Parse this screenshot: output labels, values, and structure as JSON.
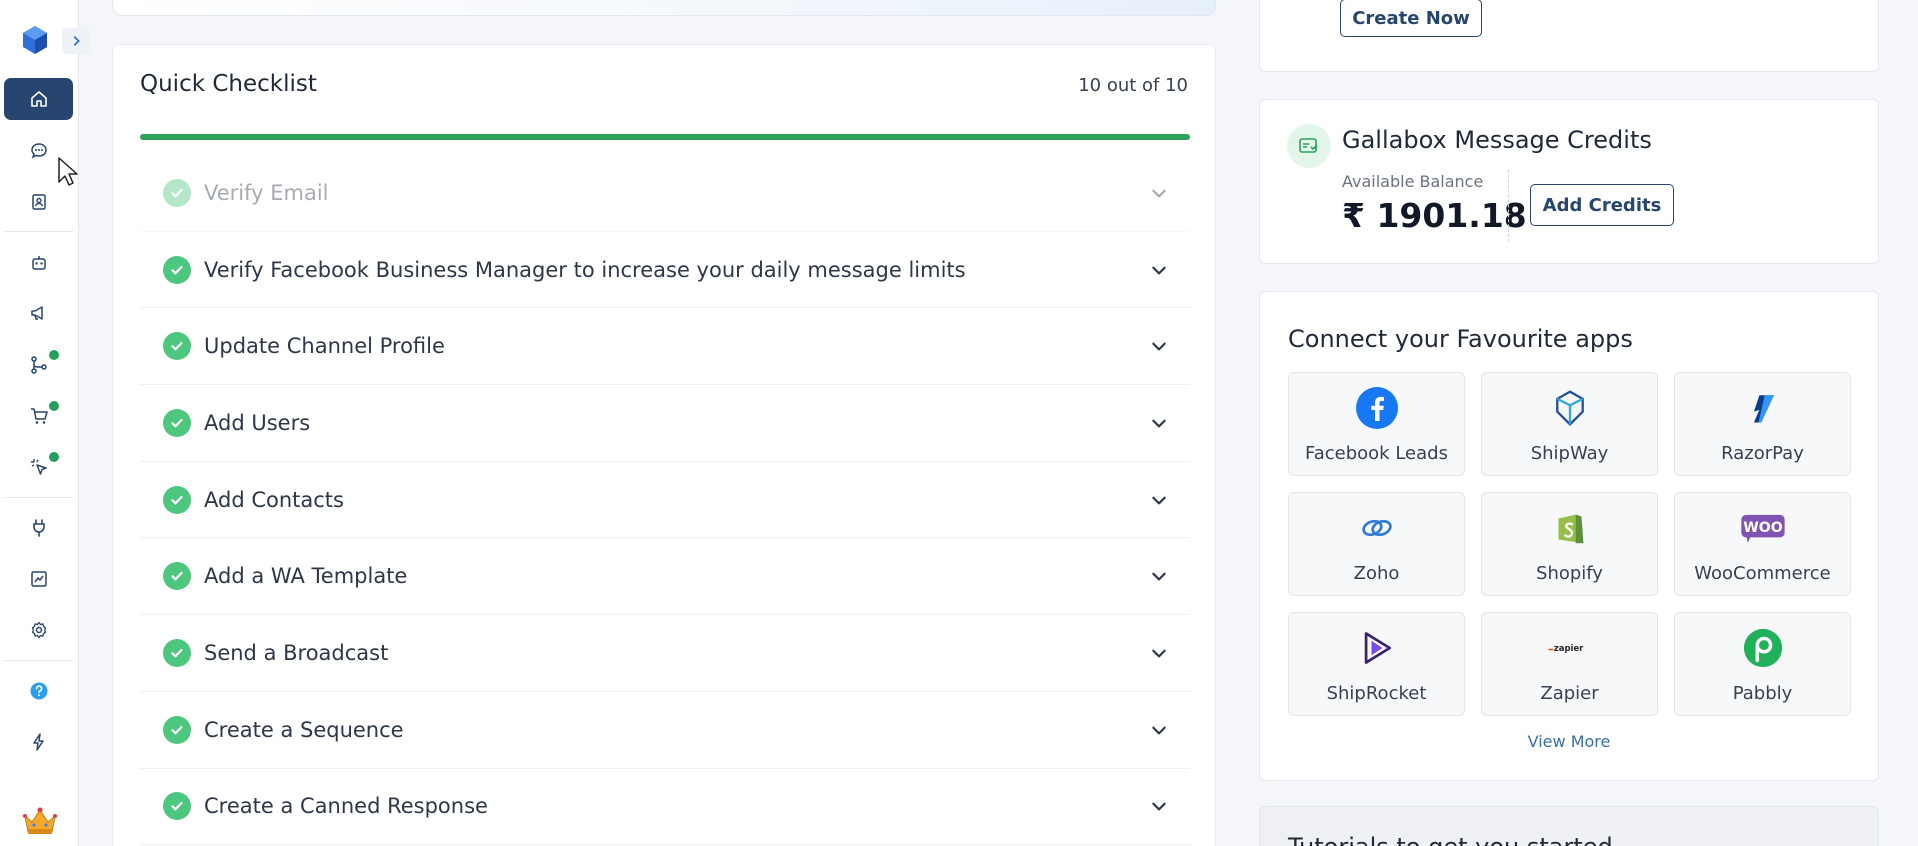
{
  "sidebar": {
    "nav": [
      {
        "id": "home",
        "icon": "home-icon",
        "active": true
      },
      {
        "id": "conversations",
        "icon": "chat-icon"
      },
      {
        "id": "contacts",
        "icon": "contacts-icon"
      },
      {
        "id": "bots",
        "icon": "bot-icon"
      },
      {
        "id": "broadcasts",
        "icon": "megaphone-icon"
      },
      {
        "id": "sequences",
        "icon": "flow-icon",
        "dot": true
      },
      {
        "id": "commerce",
        "icon": "cart-icon",
        "dot": true
      },
      {
        "id": "clicks",
        "icon": "click-icon",
        "dot": true
      },
      {
        "id": "integrations",
        "icon": "plug-icon"
      },
      {
        "id": "analytics",
        "icon": "chart-icon"
      },
      {
        "id": "settings",
        "icon": "gear-icon"
      },
      {
        "id": "help",
        "icon": "help-icon"
      },
      {
        "id": "whats-new",
        "icon": "bolt-icon"
      }
    ],
    "accent": "#27466f",
    "dot_color": "#22a05b"
  },
  "checklist": {
    "title": "Quick Checklist",
    "count": "10 out of 10",
    "progress": 1.0,
    "items": [
      {
        "label": "Verify Email",
        "faded": true
      },
      {
        "label": "Verify Facebook Business Manager to increase your daily message limits"
      },
      {
        "label": "Update Channel Profile"
      },
      {
        "label": "Add Users"
      },
      {
        "label": "Add Contacts"
      },
      {
        "label": "Add a WA Template"
      },
      {
        "label": "Send a Broadcast"
      },
      {
        "label": "Create a Sequence"
      },
      {
        "label": "Create a Canned Response"
      }
    ]
  },
  "create_card": {
    "button": "Create Now"
  },
  "credits": {
    "title": "Gallabox Message Credits",
    "balance_label": "Available Balance",
    "balance_value": "₹ 1901.18",
    "button": "Add Credits"
  },
  "apps": {
    "title": "Connect your Favourite apps",
    "items": [
      {
        "name": "Facebook Leads",
        "icon": "facebook-icon"
      },
      {
        "name": "ShipWay",
        "icon": "shipway-icon"
      },
      {
        "name": "RazorPay",
        "icon": "razorpay-icon"
      },
      {
        "name": "Zoho",
        "icon": "zoho-icon"
      },
      {
        "name": "Shopify",
        "icon": "shopify-icon"
      },
      {
        "name": "WooCommerce",
        "icon": "woocommerce-icon"
      },
      {
        "name": "ShipRocket",
        "icon": "shiprocket-icon"
      },
      {
        "name": "Zapier",
        "icon": "zapier-icon"
      },
      {
        "name": "Pabbly",
        "icon": "pabbly-icon"
      }
    ],
    "view_more": "View More"
  },
  "tutorials": {
    "title": "Tutorials to get you started"
  }
}
